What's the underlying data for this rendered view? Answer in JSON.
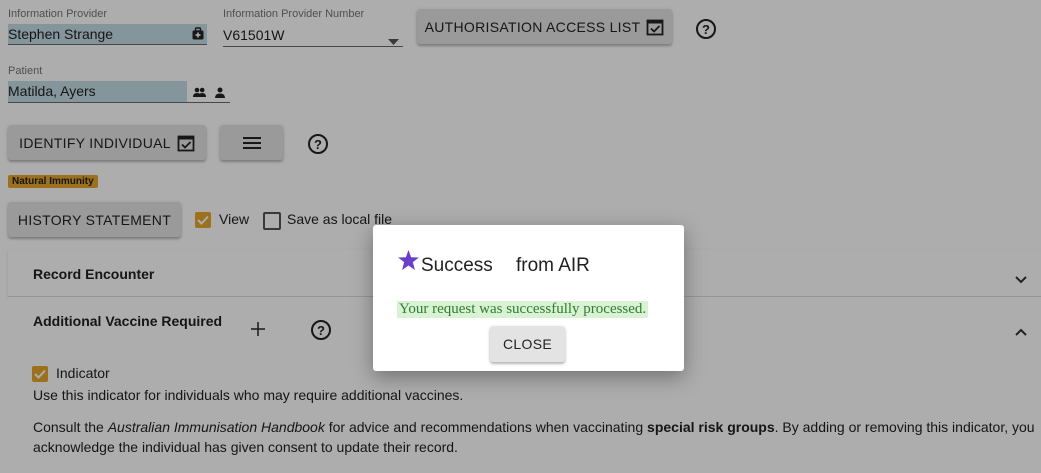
{
  "provider": {
    "label": "Information Provider",
    "value": "Stephen Strange",
    "number_label": "Information Provider Number",
    "number_value": "V61501W",
    "auth_button": "AUTHORISATION ACCESS LIST"
  },
  "patient": {
    "label": "Patient",
    "value": "Matilda, Ayers"
  },
  "actions": {
    "identify_button": "IDENTIFY INDIVIDUAL",
    "badge": "Natural Immunity",
    "history_button": "HISTORY STATEMENT",
    "view_label": "View",
    "save_local_label": "Save as local file"
  },
  "record_encounter": {
    "title": "Record Encounter"
  },
  "additional_vaccine": {
    "title": "Additional Vaccine Required",
    "indicator_label": "Indicator",
    "line1": "Use this indicator for individuals who may require additional vaccines.",
    "consult_prefix": "Consult the ",
    "handbook": "Australian Immunisation Handbook",
    "consult_mid": " for advice and recommendations when vaccinating ",
    "special": "special risk groups",
    "consult_suffix": ". By adding or removing this indicator, you",
    "line3": "acknowledge the individual has given consent to update their record."
  },
  "dialog": {
    "title": "Success",
    "source": "from AIR",
    "message": "Your request was successfully processed.",
    "close_button": "CLOSE"
  },
  "colors": {
    "filled_field": "#c4dce6",
    "badge": "#e6a52b",
    "star": "#6a3fc8",
    "success_text": "#2e7d32",
    "success_bg": "#d9f2d3"
  }
}
